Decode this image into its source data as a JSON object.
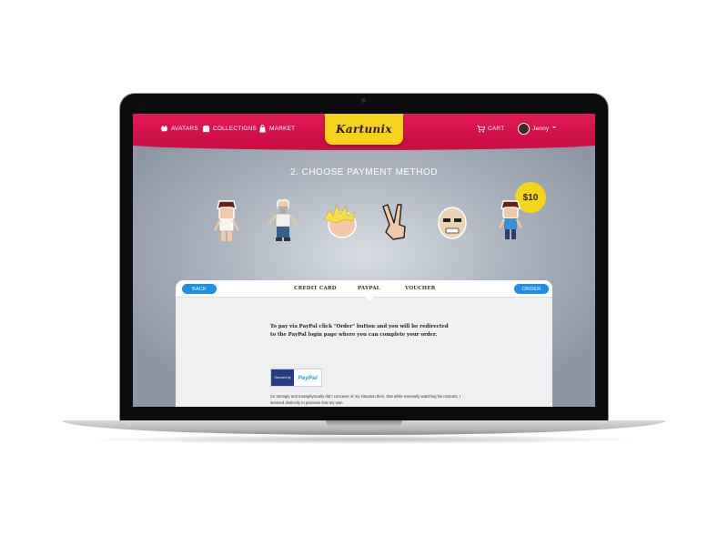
{
  "header": {
    "nav": [
      {
        "label": "AVATARS",
        "icon": "avatar-icon"
      },
      {
        "label": "COLLECTIONS",
        "icon": "collections-icon"
      },
      {
        "label": "MARKET",
        "icon": "shopping-bag-icon"
      }
    ],
    "logo": "Kartunix",
    "cart": {
      "label": "CART",
      "icon": "cart-icon"
    },
    "user": {
      "name": "Jenny",
      "icon": "chevron-down-icon"
    }
  },
  "page": {
    "title": "2. CHOOSE PAYMENT METHOD",
    "price": "$10"
  },
  "stickers": [
    "boy-sticker",
    "bearded-man-sticker",
    "blonde-hair-sticker",
    "peace-hand-sticker",
    "bald-head-sticker",
    "boy-standing-sticker"
  ],
  "payment": {
    "back_label": "BACK",
    "order_label": "ORDER",
    "tabs": [
      "CREDIT CARD",
      "PAYPAL",
      "VOUCHER"
    ],
    "active_tab": "PAYPAL",
    "instructions": "To pay via PayPal click \"Order\" button and you will be redirected to the PayPal login page where you can complete your order.",
    "badge_left": "Secured by",
    "badge_right": "PayPal",
    "body_text": "So strongly and metaphysically did I conceive of my situation then, that while earnestly watching his motions, I seemed distinctly to perceive that my own"
  },
  "colors": {
    "brand": "#d3124a",
    "logo_bg": "#f7d41b",
    "button": "#1e8fe8",
    "badge": "#f6d517"
  }
}
